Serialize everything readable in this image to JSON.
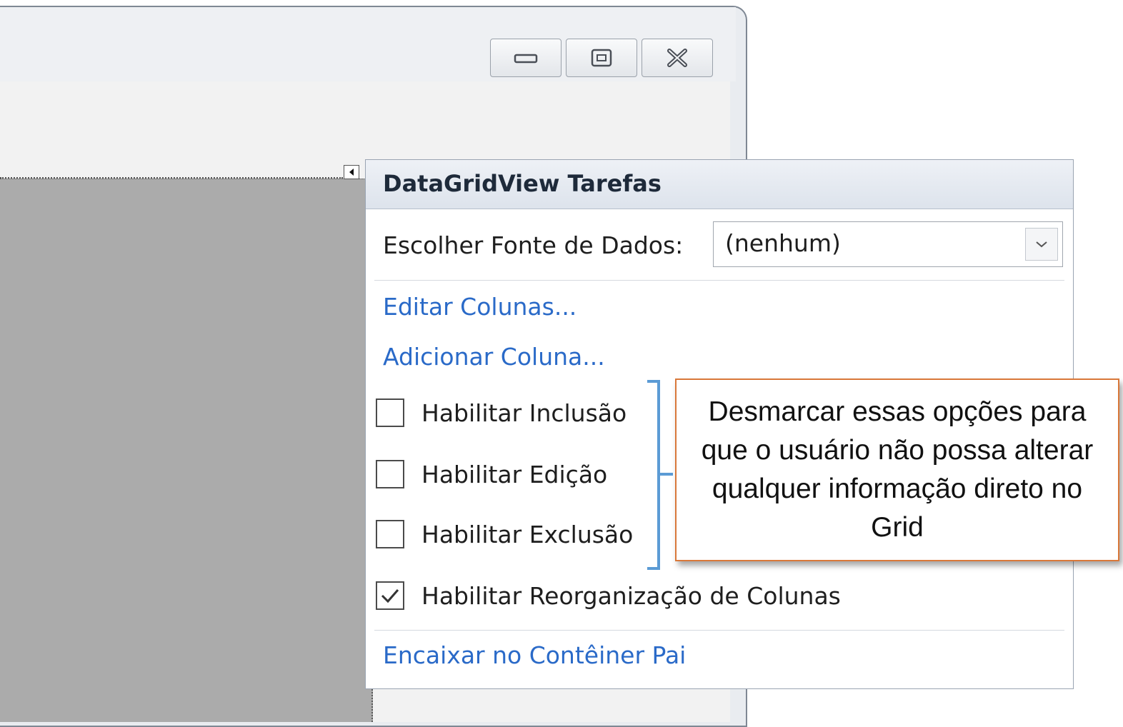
{
  "window": {
    "buttons": [
      {
        "icon": "minimize-icon"
      },
      {
        "icon": "maximize-icon"
      },
      {
        "icon": "close-icon"
      }
    ]
  },
  "panel": {
    "title": "DataGridView Tarefas",
    "data_source": {
      "label": "Escolher Fonte de Dados:",
      "value": "(nenhum)"
    },
    "links": {
      "edit_columns": "Editar Colunas...",
      "add_column": "Adicionar Coluna...",
      "dock": "Encaixar no Contêiner Pai"
    },
    "options": [
      {
        "label": "Habilitar Inclusão",
        "checked": false
      },
      {
        "label": "Habilitar Edição",
        "checked": false
      },
      {
        "label": "Habilitar Exclusão",
        "checked": false
      },
      {
        "label": "Habilitar Reorganização de Colunas",
        "checked": true
      }
    ]
  },
  "annotation": {
    "text": "Desmarcar essas opções para que o usuário não possa alterar qualquer informação direto no Grid",
    "border_color": "#d9783a",
    "bracket_color": "#5b9bd5"
  },
  "colors": {
    "link": "#2a6ac8",
    "grid_background": "#ababab"
  }
}
